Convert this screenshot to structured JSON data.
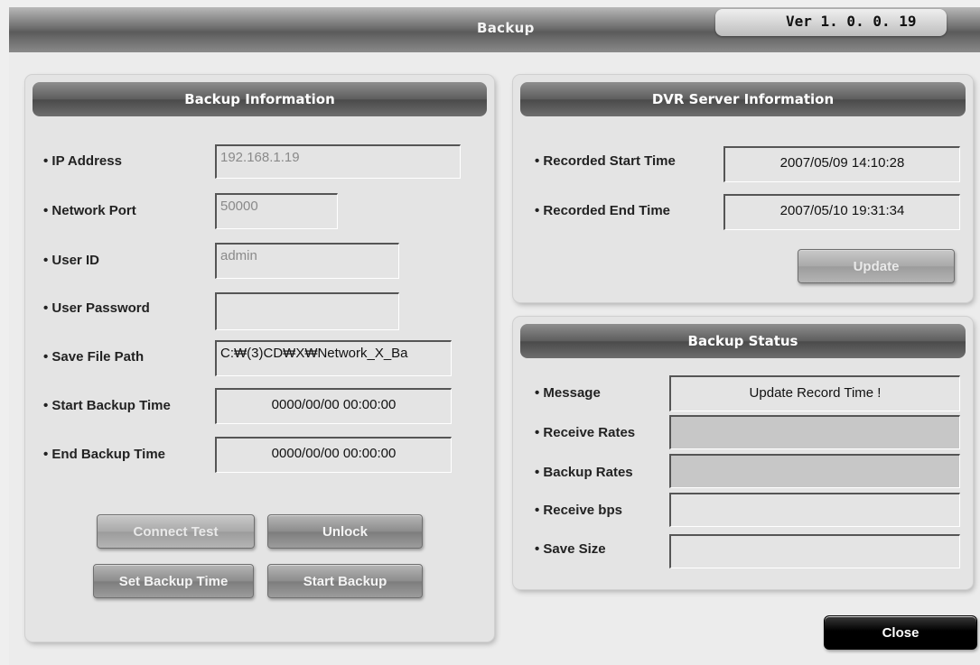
{
  "window": {
    "title": "Backup",
    "version": "Ver 1. 0. 0. 19"
  },
  "backup_info": {
    "header": "Backup Information",
    "ip_label": "• IP Address",
    "ip_value": "192.168.1.19",
    "port_label": "• Network Port",
    "port_value": "50000",
    "user_label": "• User ID",
    "user_value": "admin",
    "password_label": "• User Password",
    "password_value": "",
    "path_label": "• Save File Path",
    "path_value": "C:₩(3)CD₩X₩Network_X_Ba",
    "start_label": "• Start Backup Time",
    "start_value": "0000/00/00 00:00:00",
    "end_label": "• End Backup Time",
    "end_value": "0000/00/00 00:00:00",
    "connect_test": "Connect Test",
    "unlock": "Unlock",
    "set_backup_time": "Set Backup Time",
    "start_backup": "Start Backup"
  },
  "dvr_info": {
    "header": "DVR Server Information",
    "rec_start_label": "• Recorded Start Time",
    "rec_start_value": "2007/05/09 14:10:28",
    "rec_end_label": "• Recorded End Time",
    "rec_end_value": "2007/05/10 19:31:34",
    "update": "Update"
  },
  "backup_status": {
    "header": "Backup Status",
    "message_label": "• Message",
    "message_value": "Update Record Time !",
    "receive_rates_label": "• Receive Rates",
    "backup_rates_label": "• Backup Rates",
    "receive_bps_label": "• Receive bps",
    "save_size_label": "• Save Size"
  },
  "close": "Close"
}
